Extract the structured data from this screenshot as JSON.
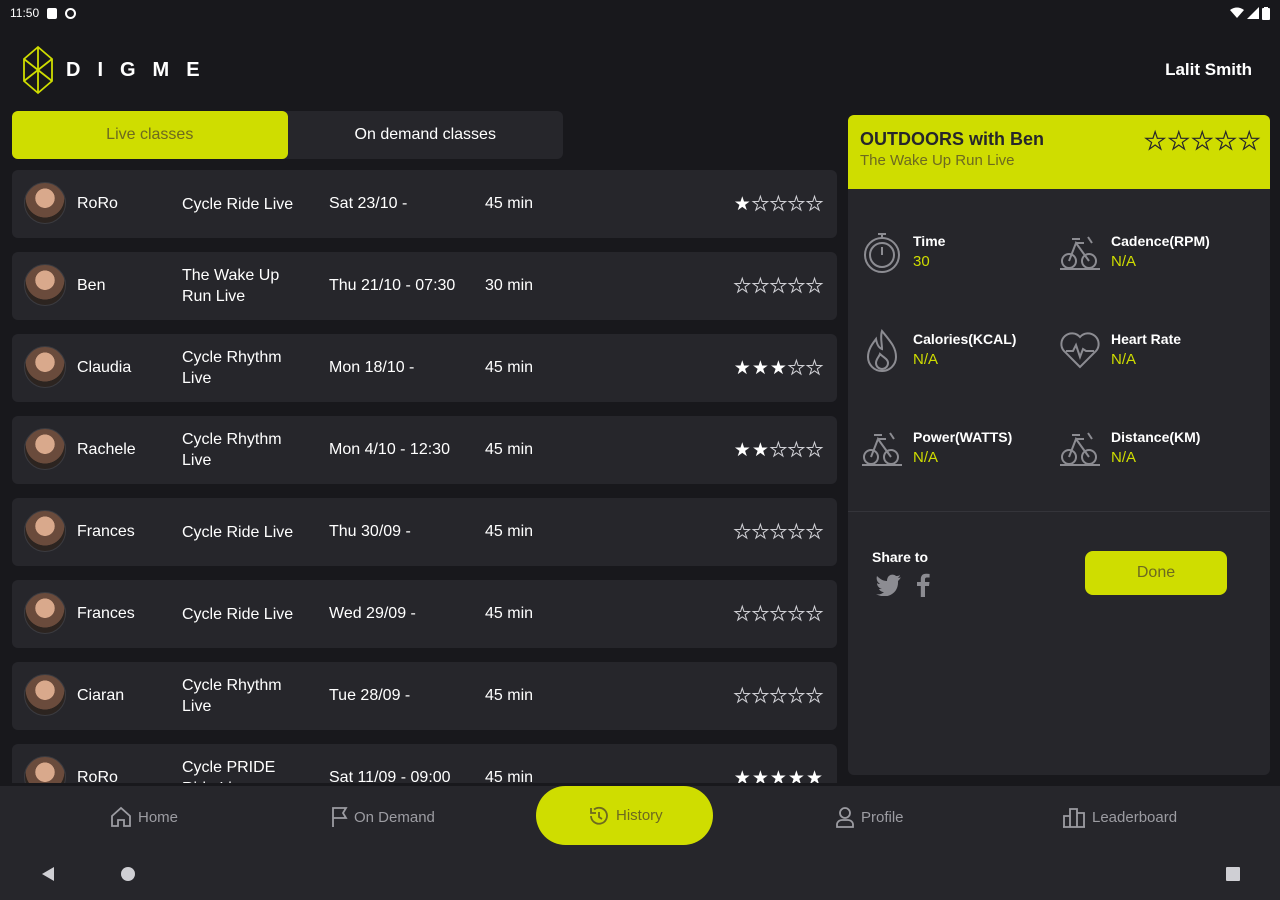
{
  "status_bar": {
    "time": "11:50"
  },
  "header": {
    "brand": "DIGME",
    "user_name": "Lalit Smith"
  },
  "tabs": [
    {
      "label": "Live classes",
      "active": true
    },
    {
      "label": "On demand classes",
      "active": false
    }
  ],
  "classes": [
    {
      "instructor": "RoRo",
      "class_name": "Cycle Ride Live",
      "date": "Sat 23/10 -",
      "duration": "45 min",
      "rating": 1
    },
    {
      "instructor": "Ben",
      "class_name": "The Wake Up Run Live",
      "date": "Thu 21/10 - 07:30",
      "duration": "30 min",
      "rating": 0
    },
    {
      "instructor": "Claudia",
      "class_name": "Cycle Rhythm Live",
      "date": "Mon 18/10 -",
      "duration": "45 min",
      "rating": 3
    },
    {
      "instructor": "Rachele",
      "class_name": "Cycle Rhythm Live",
      "date": "Mon 4/10 - 12:30",
      "duration": "45 min",
      "rating": 2
    },
    {
      "instructor": "Frances",
      "class_name": "Cycle Ride Live",
      "date": "Thu 30/09 -",
      "duration": "45 min",
      "rating": 0
    },
    {
      "instructor": "Frances",
      "class_name": "Cycle Ride Live",
      "date": "Wed 29/09 -",
      "duration": "45 min",
      "rating": 0
    },
    {
      "instructor": "Ciaran",
      "class_name": "Cycle Rhythm Live",
      "date": "Tue 28/09 -",
      "duration": "45 min",
      "rating": 0
    },
    {
      "instructor": "RoRo",
      "class_name": "Cycle PRIDE Ride Live",
      "date": "Sat 11/09 - 09:00",
      "duration": "45 min",
      "rating": 5
    }
  ],
  "detail": {
    "title": "OUTDOORS with Ben",
    "subtitle": "The Wake Up Run Live",
    "rating": 0,
    "metrics": [
      {
        "label": "Time",
        "value": "30",
        "icon": "stopwatch-icon"
      },
      {
        "label": "Cadence(RPM)",
        "value": "N/A",
        "icon": "bike-icon"
      },
      {
        "label": "Calories(KCAL)",
        "value": "N/A",
        "icon": "flame-icon"
      },
      {
        "label": "Heart Rate",
        "value": "N/A",
        "icon": "heart-rate-icon"
      },
      {
        "label": "Power(WATTS)",
        "value": "N/A",
        "icon": "bike-icon"
      },
      {
        "label": "Distance(KM)",
        "value": "N/A",
        "icon": "bike-icon"
      }
    ],
    "share_label": "Share to",
    "done_label": "Done"
  },
  "nav": {
    "items": [
      {
        "label": "Home",
        "icon": "home-icon"
      },
      {
        "label": "On Demand",
        "icon": "flag-icon"
      },
      {
        "label": "History",
        "icon": "history-icon",
        "active": true
      },
      {
        "label": "Profile",
        "icon": "profile-icon"
      },
      {
        "label": "Leaderboard",
        "icon": "leaderboard-icon"
      }
    ]
  },
  "colors": {
    "accent": "#cfdd00",
    "background": "#18181c",
    "card": "#26262b"
  }
}
